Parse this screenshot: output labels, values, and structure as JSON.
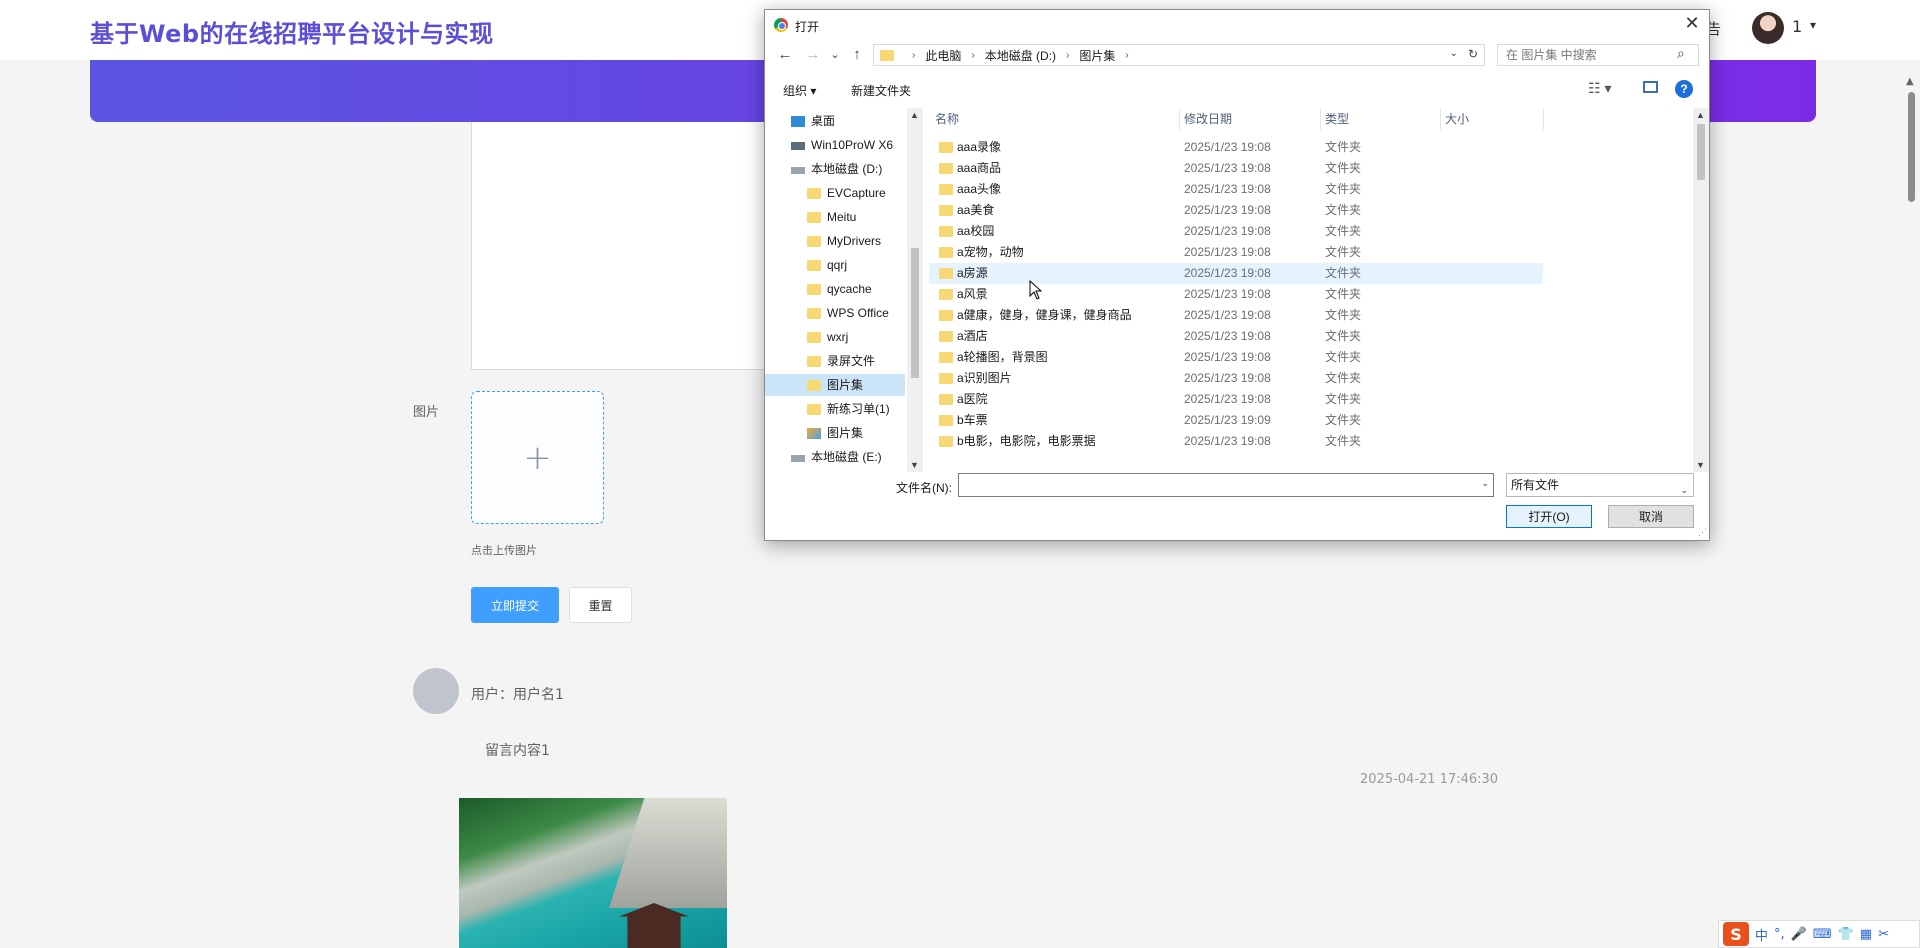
{
  "header": {
    "site_title": "基于Web的在线招聘平台设计与实现",
    "notice_fragment": "告",
    "user_number": "1",
    "caret": "▾"
  },
  "form": {
    "image_label": "图片",
    "upload_plus": "+",
    "upload_hint": "点击上传图片",
    "submit_label": "立即提交",
    "reset_label": "重置"
  },
  "comment": {
    "user": "用户：用户名1",
    "content": "留言内容1",
    "time": "2025-04-21 17:46:30"
  },
  "ime": {
    "logo": "S",
    "items": [
      "中",
      "°,",
      "🎤",
      "⌨",
      "👕",
      "▦",
      "✂"
    ]
  },
  "dialog": {
    "title": "打开",
    "close": "✕",
    "nav": {
      "back": "←",
      "forward": "→",
      "recent": "⌄",
      "up": "↑"
    },
    "breadcrumb": [
      "此电脑",
      "本地磁盘 (D:)",
      "图片集"
    ],
    "crumb_sep": "›",
    "addr_dropdown": "⌄",
    "refresh": "↻",
    "search_placeholder": "在 图片集 中搜索",
    "search_icon": "⌕",
    "toolbar": {
      "organize": "组织 ▾",
      "new_folder": "新建文件夹",
      "view": "☷ ▾",
      "help": "?"
    },
    "tree": [
      {
        "label": "桌面",
        "icon": "desktop",
        "indent": 26
      },
      {
        "label": "Win10ProW X6",
        "icon": "pc",
        "indent": 26
      },
      {
        "label": "本地磁盘 (D:)",
        "icon": "drive",
        "indent": 26
      },
      {
        "label": "EVCapture",
        "icon": "folder",
        "indent": 42
      },
      {
        "label": "Meitu",
        "icon": "folder",
        "indent": 42
      },
      {
        "label": "MyDrivers",
        "icon": "folder",
        "indent": 42
      },
      {
        "label": "qqrj",
        "icon": "folder",
        "indent": 42
      },
      {
        "label": "qycache",
        "icon": "folder",
        "indent": 42
      },
      {
        "label": "WPS Office",
        "icon": "folder",
        "indent": 42
      },
      {
        "label": "wxrj",
        "icon": "folder",
        "indent": 42
      },
      {
        "label": "录屏文件",
        "icon": "folder",
        "indent": 42
      },
      {
        "label": "图片集",
        "icon": "folder",
        "indent": 42,
        "selected": true
      },
      {
        "label": "新练习单(1)",
        "icon": "folder",
        "indent": 42
      },
      {
        "label": "图片集",
        "icon": "gallery",
        "indent": 42
      },
      {
        "label": "本地磁盘 (E:)",
        "icon": "drive",
        "indent": 26
      }
    ],
    "columns": {
      "name": "名称",
      "date": "修改日期",
      "type": "类型",
      "size": "大小",
      "sort_arrow": "^"
    },
    "files": [
      {
        "name": "aaa录像",
        "date": "2025/1/23 19:08",
        "type": "文件夹"
      },
      {
        "name": "aaa商品",
        "date": "2025/1/23 19:08",
        "type": "文件夹"
      },
      {
        "name": "aaa头像",
        "date": "2025/1/23 19:08",
        "type": "文件夹"
      },
      {
        "name": "aa美食",
        "date": "2025/1/23 19:08",
        "type": "文件夹"
      },
      {
        "name": "aa校园",
        "date": "2025/1/23 19:08",
        "type": "文件夹"
      },
      {
        "name": "a宠物，动物",
        "date": "2025/1/23 19:08",
        "type": "文件夹"
      },
      {
        "name": "a房源",
        "date": "2025/1/23 19:08",
        "type": "文件夹",
        "hover": true
      },
      {
        "name": "a风景",
        "date": "2025/1/23 19:08",
        "type": "文件夹"
      },
      {
        "name": "a健康，健身，健身课，健身商品",
        "date": "2025/1/23 19:08",
        "type": "文件夹"
      },
      {
        "name": "a酒店",
        "date": "2025/1/23 19:08",
        "type": "文件夹"
      },
      {
        "name": "a轮播图，背景图",
        "date": "2025/1/23 19:08",
        "type": "文件夹"
      },
      {
        "name": "a识别图片",
        "date": "2025/1/23 19:08",
        "type": "文件夹"
      },
      {
        "name": "a医院",
        "date": "2025/1/23 19:08",
        "type": "文件夹"
      },
      {
        "name": "b车票",
        "date": "2025/1/23 19:09",
        "type": "文件夹"
      },
      {
        "name": "b电影，电影院，电影票据",
        "date": "2025/1/23 19:08",
        "type": "文件夹"
      }
    ],
    "scroll_up": "▲",
    "scroll_down": "▼",
    "filename_label": "文件名(N):",
    "filename_value": "",
    "dropdown": "⌄",
    "filetype": "所有文件",
    "open_label": "打开(O)",
    "cancel_label": "取消",
    "grip": "⋰"
  }
}
